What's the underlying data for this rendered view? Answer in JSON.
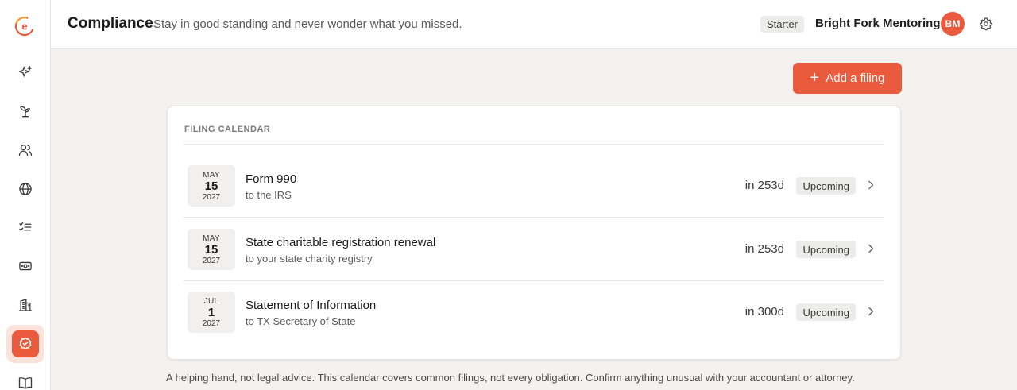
{
  "header": {
    "title": "Compliance",
    "subtitle": "Stay in good standing and never wonder what you missed.",
    "plan": "Starter",
    "org_name": "Bright Fork Mentoring",
    "avatar_initials": "BM"
  },
  "sidebar": {
    "logo_letter": "e",
    "items": [
      {
        "icon": "sparkle-icon"
      },
      {
        "icon": "sprout-icon"
      },
      {
        "icon": "people-icon"
      },
      {
        "icon": "globe-icon"
      },
      {
        "icon": "checklist-icon"
      },
      {
        "icon": "money-icon"
      },
      {
        "icon": "building-icon"
      },
      {
        "icon": "compliance-check-icon",
        "active": true
      },
      {
        "icon": "book-icon"
      }
    ]
  },
  "actions": {
    "add_filing_label": "Add a filing"
  },
  "calendar": {
    "heading": "FILING CALENDAR",
    "filings": [
      {
        "month": "MAY",
        "day": "15",
        "year": "2027",
        "title": "Form 990",
        "subtitle": "to the IRS",
        "due_in": "in 253d",
        "status": "Upcoming"
      },
      {
        "month": "MAY",
        "day": "15",
        "year": "2027",
        "title": "State charitable registration renewal",
        "subtitle": "to your state charity registry",
        "due_in": "in 253d",
        "status": "Upcoming"
      },
      {
        "month": "JUL",
        "day": "1",
        "year": "2027",
        "title": "Statement of Information",
        "subtitle": "to TX Secretary of State",
        "due_in": "in 300d",
        "status": "Upcoming"
      }
    ]
  },
  "footer": {
    "disclaimer": "A helping hand, not legal advice. This calendar covers common filings, not every obligation. Confirm anything unusual with your accountant or attorney."
  },
  "colors": {
    "accent": "#ea5a3c",
    "background": "#f3f2f0"
  }
}
